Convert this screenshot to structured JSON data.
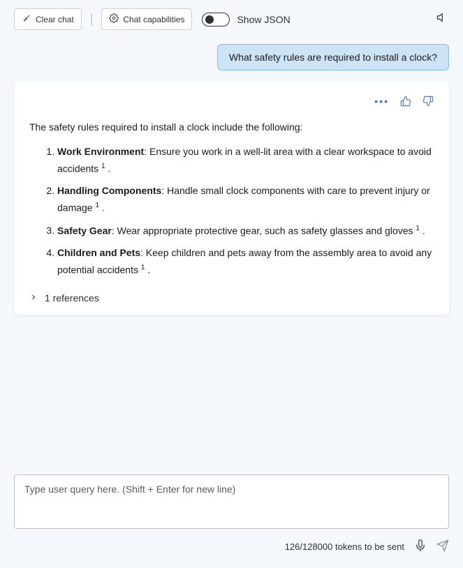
{
  "toolbar": {
    "clear_chat_label": "Clear chat",
    "chat_capabilities_label": "Chat capabilities",
    "show_json_label": "Show JSON"
  },
  "user_message": "What safety rules are required to install a clock?",
  "assistant": {
    "intro": "The safety rules required to install a clock include the following:",
    "items": [
      {
        "title": "Work Environment",
        "text": ": Ensure you work in a well-lit area with a clear workspace to avoid accidents",
        "ref": "1"
      },
      {
        "title": "Handling Components",
        "text": ": Handle small clock components with care to prevent injury or damage",
        "ref": "1"
      },
      {
        "title": "Safety Gear",
        "text": ": Wear appropriate protective gear, such as safety glasses and gloves",
        "ref": "1"
      },
      {
        "title": "Children and Pets",
        "text": ": Keep children and pets away from the assembly area to avoid any potential accidents",
        "ref": "1"
      }
    ],
    "references_label": "1 references"
  },
  "input": {
    "placeholder": "Type user query here. (Shift + Enter for new line)",
    "token_status": "126/128000 tokens to be sent"
  }
}
